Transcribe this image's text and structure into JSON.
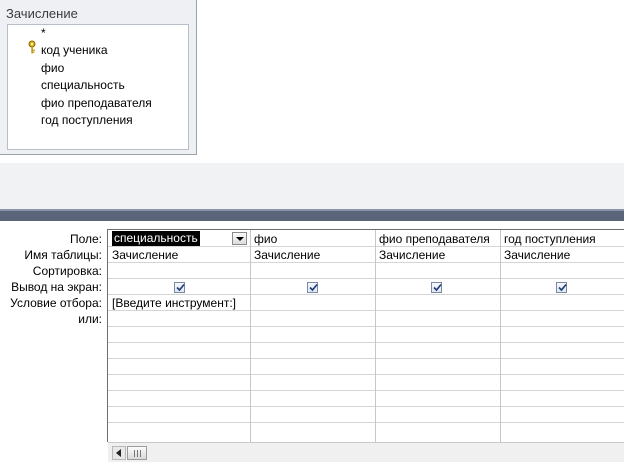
{
  "table_box": {
    "title": "Зачисление",
    "fields": [
      "*",
      "код ученика",
      "фио",
      "специальность",
      "фио преподавателя",
      "год поступления"
    ],
    "key_field_index": 1
  },
  "grid": {
    "row_labels": [
      "Поле:",
      "Имя таблицы:",
      "Сортировка:",
      "Вывод на экран:",
      "Условие отбора:",
      "или:"
    ],
    "columns": [
      {
        "field": "специальность",
        "table": "Зачисление",
        "sort": "",
        "show": true,
        "criteria": "[Введите инструмент:]",
        "selected": true
      },
      {
        "field": "фио",
        "table": "Зачисление",
        "sort": "",
        "show": true,
        "criteria": ""
      },
      {
        "field": "фио преподавателя",
        "table": "Зачисление",
        "sort": "",
        "show": true,
        "criteria": ""
      },
      {
        "field": "год поступления",
        "table": "Зачисление",
        "sort": "",
        "show": true,
        "criteria": ""
      }
    ]
  },
  "colors": {
    "splitter": "#5a6579",
    "upper_background": "#f1f2f4",
    "selection": "#000000"
  }
}
